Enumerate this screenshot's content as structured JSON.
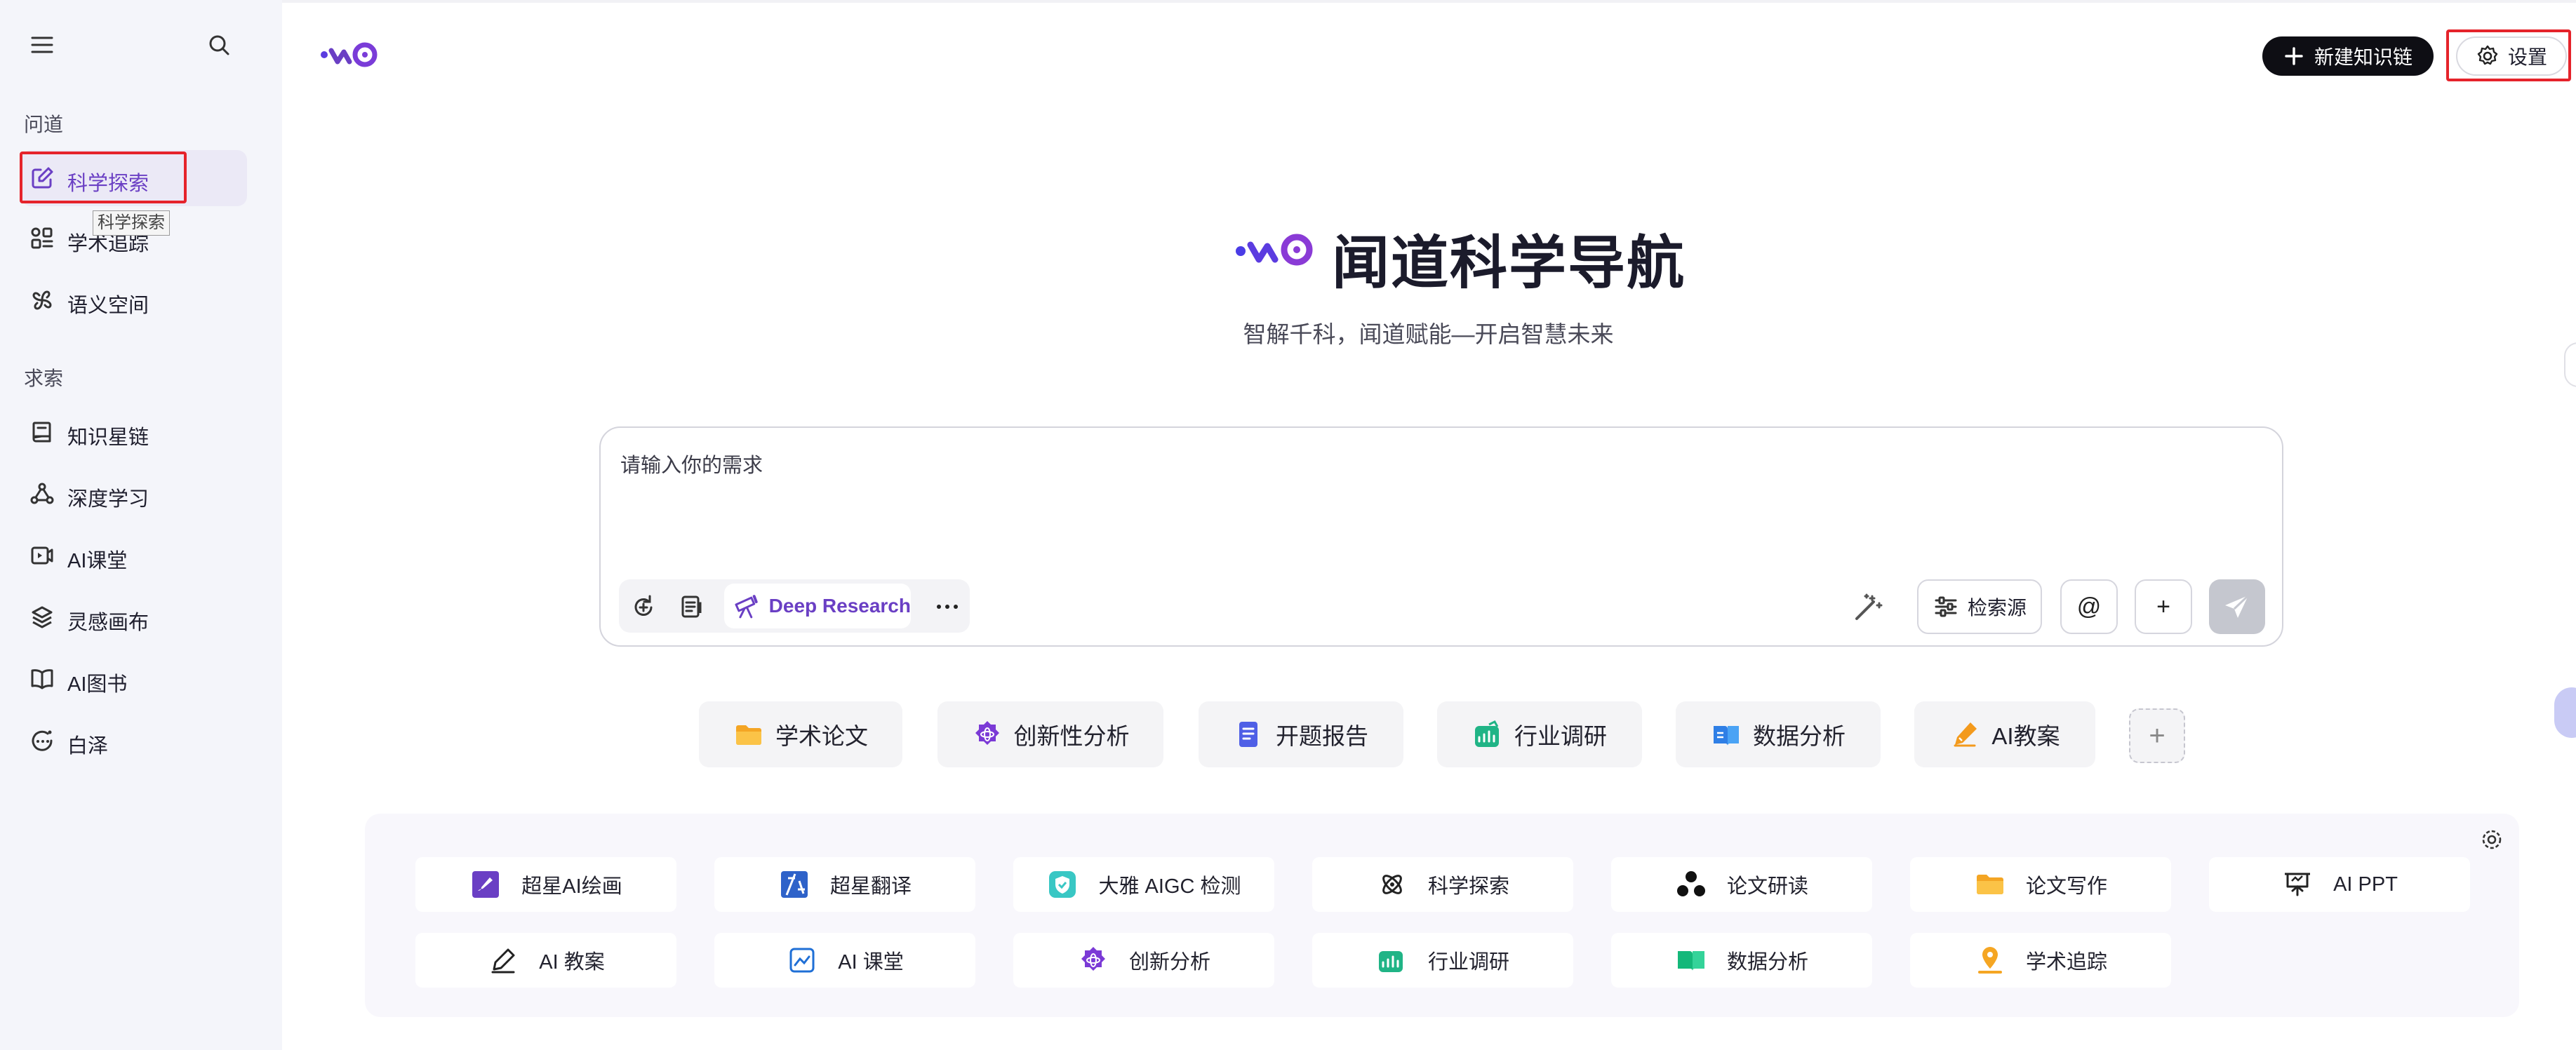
{
  "sidebar": {
    "section1": "问道",
    "section2": "求索",
    "items": [
      {
        "label": "科学探索",
        "icon": "edit-square-icon"
      },
      {
        "label": "学术追踪",
        "icon": "apps-grid-icon"
      },
      {
        "label": "语义空间",
        "icon": "flower-icon"
      },
      {
        "label": "知识星链",
        "icon": "book-icon"
      },
      {
        "label": "深度学习",
        "icon": "molecule-icon"
      },
      {
        "label": "AI课堂",
        "icon": "video-play-icon"
      },
      {
        "label": "灵感画布",
        "icon": "layers-icon"
      },
      {
        "label": "AI图书",
        "icon": "open-book-icon"
      },
      {
        "label": "白泽",
        "icon": "chat-dots-icon"
      }
    ],
    "tooltip": "科学探索"
  },
  "header": {
    "new_chain_label": "新建知识链",
    "settings_label": "设置"
  },
  "hero": {
    "title": "闻道科学导航",
    "subtitle": "智解千科，闻道赋能—开启智慧未来"
  },
  "input": {
    "placeholder": "请输入你的需求",
    "deep_research_label": "Deep Research",
    "source_label": "检索源",
    "at_label": "@",
    "plus_label": "+"
  },
  "chips": [
    {
      "label": "学术论文",
      "icon": "folder-icon"
    },
    {
      "label": "创新性分析",
      "icon": "atom-badge-icon"
    },
    {
      "label": "开题报告",
      "icon": "document-icon"
    },
    {
      "label": "行业调研",
      "icon": "chart-up-icon"
    },
    {
      "label": "数据分析",
      "icon": "book-data-icon"
    },
    {
      "label": "AI教案",
      "icon": "pen-icon"
    }
  ],
  "chip_add_label": "+",
  "tools": [
    {
      "label": "超星AI绘画",
      "icon": "paint-icon"
    },
    {
      "label": "超星翻译",
      "icon": "translate-icon"
    },
    {
      "label": "大雅 AIGC 检测",
      "icon": "shield-check-icon"
    },
    {
      "label": "科学探索",
      "icon": "atom-icon"
    },
    {
      "label": "论文研读",
      "icon": "nodes-icon"
    },
    {
      "label": "论文写作",
      "icon": "folder-icon"
    },
    {
      "label": "AI PPT",
      "icon": "presentation-icon"
    },
    {
      "label": "AI 教案",
      "icon": "pen-outline-icon"
    },
    {
      "label": "AI 课堂",
      "icon": "classroom-icon"
    },
    {
      "label": "创新分析",
      "icon": "atom-badge-icon"
    },
    {
      "label": "行业调研",
      "icon": "chart-up-icon"
    },
    {
      "label": "数据分析",
      "icon": "book-data-icon"
    },
    {
      "label": "学术追踪",
      "icon": "location-icon"
    }
  ],
  "colors": {
    "accent": "#6a3fc4",
    "highlight": "#e5232b",
    "sidebar_bg": "#f4f5fa",
    "dark_button": "#0e0e14"
  }
}
